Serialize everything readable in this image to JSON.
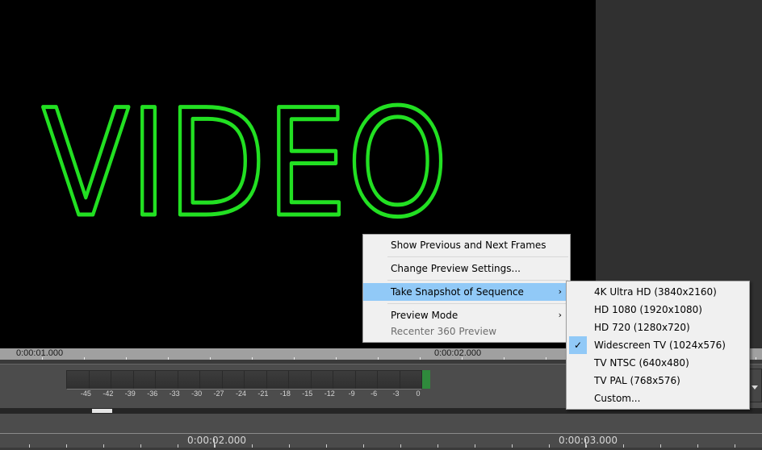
{
  "preview": {
    "title_text": "VIDEO",
    "title_color": "#22e022",
    "background": "#000000"
  },
  "timeline": {
    "top_ruler": {
      "labels": [
        "0:00:01.000",
        "0:00:02.000"
      ]
    },
    "audio_meter": {
      "scale": [
        "-45",
        "-42",
        "-39",
        "-36",
        "-33",
        "-30",
        "-27",
        "-24",
        "-21",
        "-18",
        "-15",
        "-12",
        "-9",
        "-6",
        "-3",
        "0"
      ],
      "clip_indicator_color": "#2f8a3c"
    },
    "bottom_ruler": {
      "labels": [
        "0:00:02.000",
        "0:00:03.000"
      ]
    }
  },
  "context_menu": {
    "items": [
      {
        "label": "Show Previous and Next Frames",
        "submenu": false,
        "disabled": false
      },
      {
        "label": "Change Preview Settings...",
        "submenu": false,
        "disabled": false
      },
      {
        "label": "Take Snapshot of Sequence",
        "submenu": true,
        "disabled": false,
        "highlighted": true
      },
      {
        "label": "Preview Mode",
        "submenu": true,
        "disabled": false
      },
      {
        "label": "Recenter 360 Preview",
        "submenu": false,
        "disabled": true
      }
    ],
    "submenu_arrow": "›"
  },
  "snapshot_submenu": {
    "items": [
      {
        "label": "4K Ultra HD (3840x2160)",
        "checked": false
      },
      {
        "label": "HD 1080 (1920x1080)",
        "checked": false
      },
      {
        "label": "HD 720 (1280x720)",
        "checked": false
      },
      {
        "label": "Widescreen TV (1024x576)",
        "checked": true
      },
      {
        "label": "TV NTSC (640x480)",
        "checked": false
      },
      {
        "label": "TV PAL (768x576)",
        "checked": false
      },
      {
        "label": "Custom...",
        "checked": false
      }
    ],
    "check_glyph": "✓",
    "highlight_color": "#91c9f7"
  }
}
